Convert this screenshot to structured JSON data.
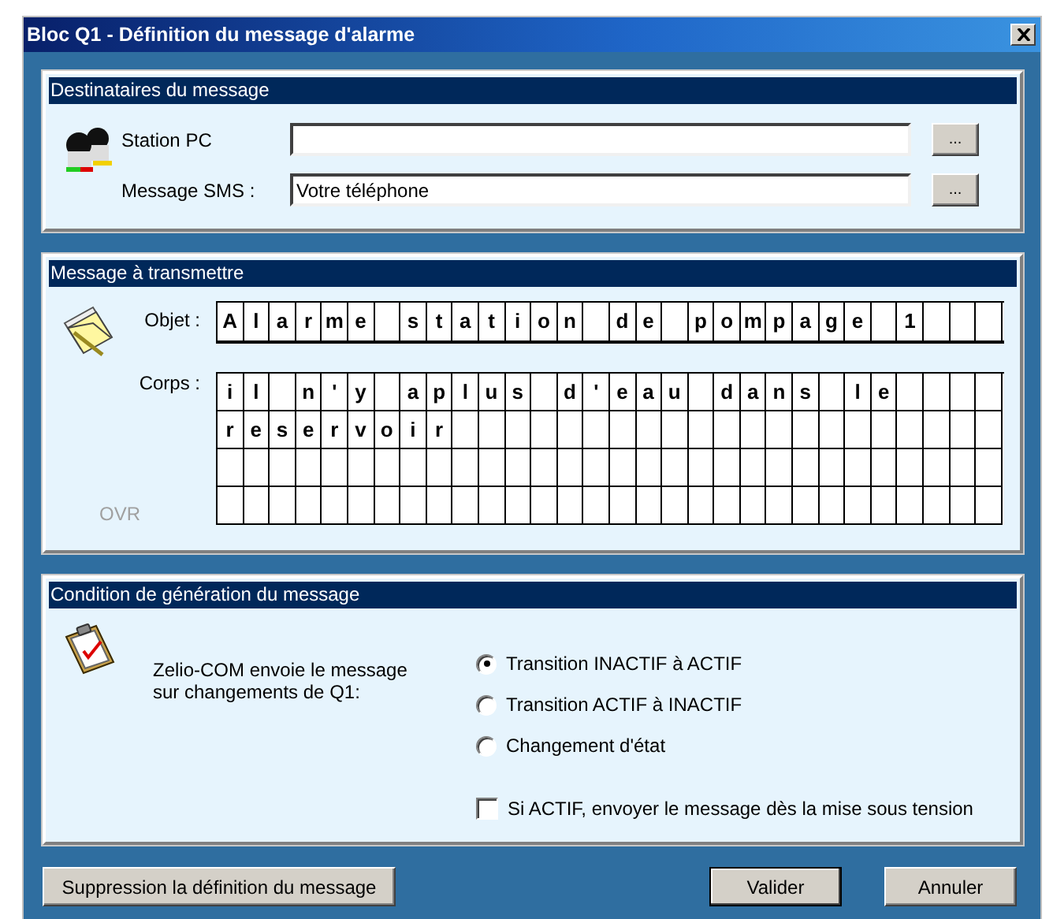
{
  "window": {
    "title": "Bloc Q1 - Définition du message d'alarme"
  },
  "recipients": {
    "title": "Destinataires du message",
    "fields": [
      {
        "label": "Station PC",
        "browse": "..."
      },
      {
        "label": "Message SMS :",
        "value": "Votre téléphone",
        "browse": "..."
      }
    ]
  },
  "message": {
    "title": "Message à transmettre",
    "subject_label": "Objet :",
    "subject_cells": [
      "A",
      "l",
      "a",
      "r",
      "m",
      "e",
      " ",
      "s",
      "t",
      "a",
      "t",
      "i",
      "o",
      "n",
      " ",
      "d",
      "e",
      " ",
      "p",
      "o",
      "m",
      "p",
      "a",
      "g",
      "e",
      " ",
      "1"
    ],
    "body_label": "Corps :",
    "body_rows": [
      {
        "cells": [
          "i",
          "l",
          " ",
          "n",
          "'",
          "y",
          " ",
          "a",
          "p",
          "l",
          "u",
          "s",
          " ",
          "d",
          "'",
          "e",
          "a",
          "u",
          " ",
          "d",
          "a",
          "n",
          "s",
          " ",
          "l",
          "e"
        ]
      },
      {
        "cells": [
          "r",
          "e",
          "s",
          "e",
          "r",
          "v",
          "o",
          "i",
          "r"
        ]
      }
    ],
    "mode": "OVR"
  },
  "condition": {
    "title": "Condition de génération du message",
    "description": [
      "Zelio-COM envoie le message",
      "sur changements de Q1:"
    ],
    "options": [
      {
        "label": "Transition INACTIF à ACTIF",
        "selected": true
      },
      {
        "label": "Transition ACTIF à INACTIF",
        "selected": false
      },
      {
        "label": "Changement d'état",
        "selected": false
      }
    ],
    "checkbox": {
      "label": "Si ACTIF, envoyer le message dès la mise sous tension",
      "checked": false
    }
  },
  "buttons": [
    {
      "label": "Suppression la définition du message",
      "default": false
    },
    {
      "label": "Valider",
      "default": true
    },
    {
      "label": "Annuler",
      "default": false
    }
  ]
}
